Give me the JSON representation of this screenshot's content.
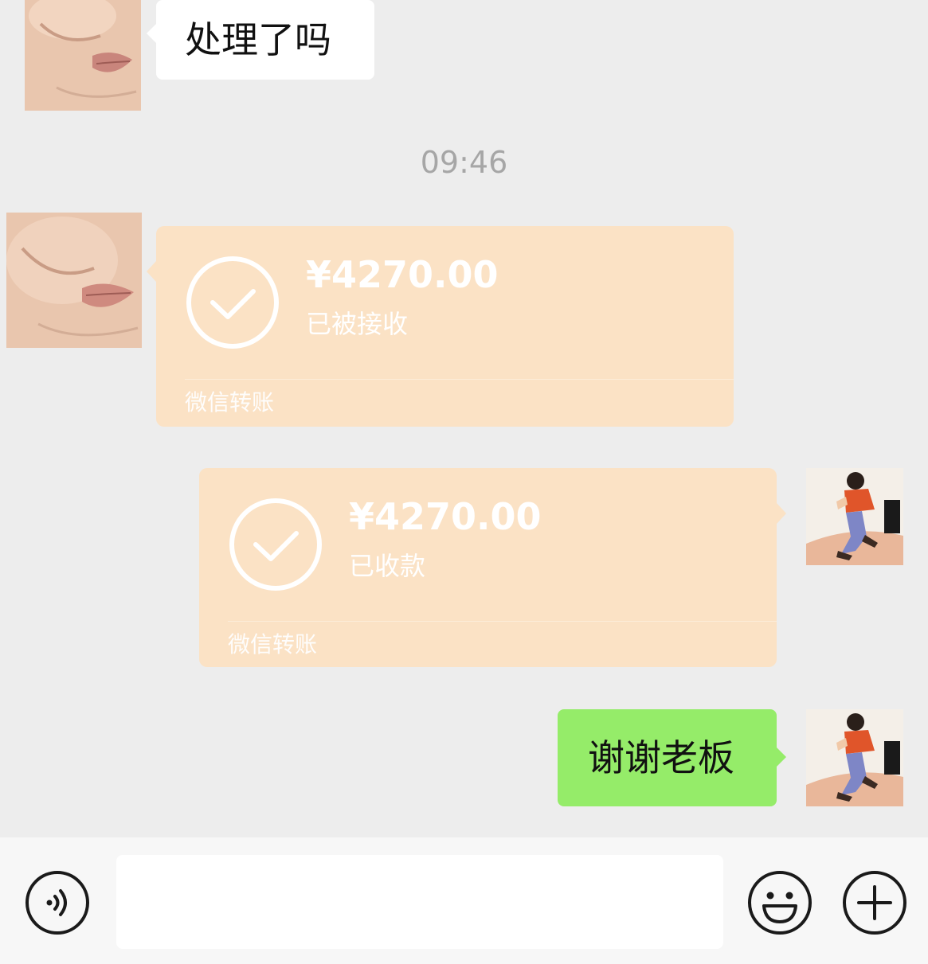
{
  "messages": {
    "first": {
      "text": "处理了吗"
    },
    "timestamp": "09:46",
    "transfer_sent": {
      "amount": "¥4270.00",
      "status": "已被接收",
      "service": "微信转账"
    },
    "transfer_received": {
      "amount": "¥4270.00",
      "status": "已收款",
      "service": "微信转账"
    },
    "reply": {
      "text": "谢谢老板"
    }
  },
  "input_bar": {
    "left_icon": "voice-icon",
    "right_icons": [
      "emoji-icon",
      "plus-icon"
    ]
  },
  "colors": {
    "background": "#ededed",
    "transfer_card": "#fbe2c5",
    "my_bubble": "#95ec69",
    "their_bubble": "#ffffff"
  }
}
